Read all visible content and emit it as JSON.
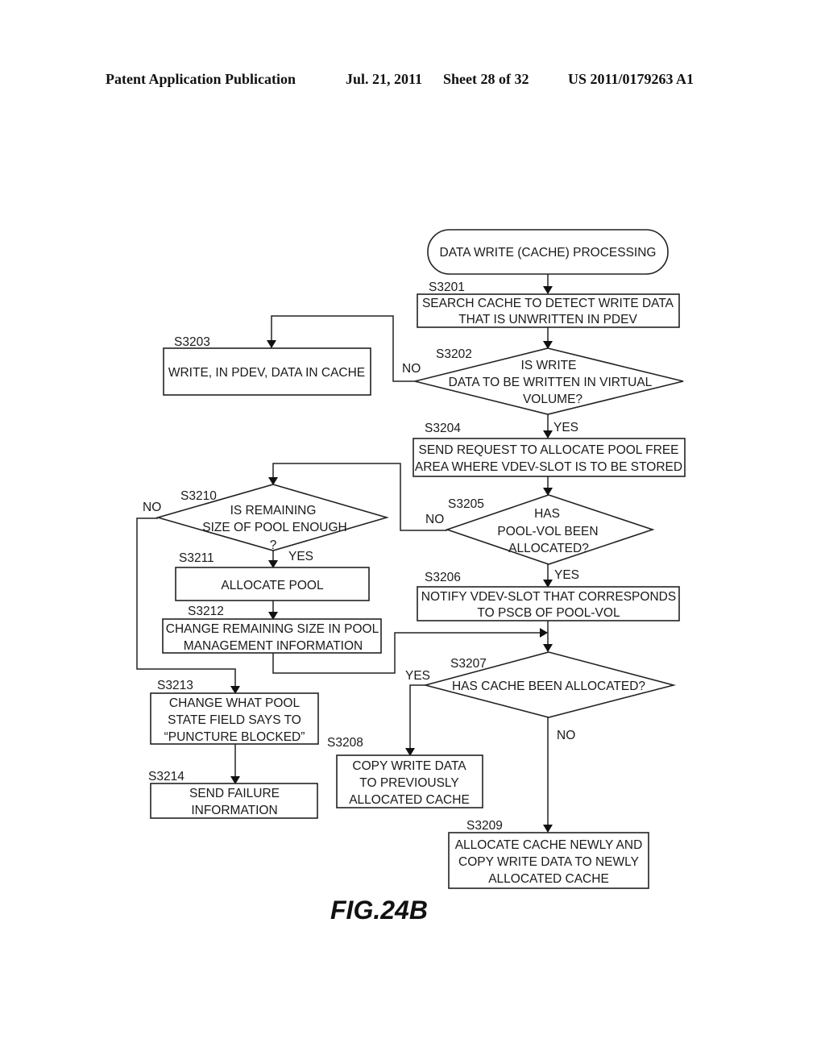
{
  "header": {
    "publication": "Patent Application Publication",
    "date": "Jul. 21, 2011",
    "sheet": "Sheet 28 of 32",
    "number": "US 2011/0179263 A1"
  },
  "figure_label": "FIG.24B",
  "nodes": {
    "start": {
      "type": "terminal",
      "lines": [
        "DATA WRITE (CACHE) PROCESSING"
      ]
    },
    "s3201": {
      "step": "S3201",
      "type": "process",
      "lines": [
        "SEARCH CACHE TO DETECT WRITE DATA",
        "THAT IS UNWRITTEN IN PDEV"
      ]
    },
    "s3202": {
      "step": "S3202",
      "type": "decision",
      "lines": [
        "IS WRITE",
        "DATA TO BE WRITTEN IN VIRTUAL",
        "VOLUME?"
      ]
    },
    "s3203": {
      "step": "S3203",
      "type": "process",
      "lines": [
        "WRITE, IN PDEV, DATA IN CACHE"
      ]
    },
    "s3204": {
      "step": "S3204",
      "type": "process",
      "lines": [
        "SEND REQUEST TO ALLOCATE POOL FREE",
        "AREA WHERE VDEV-SLOT IS TO BE STORED"
      ]
    },
    "s3205": {
      "step": "S3205",
      "type": "decision",
      "lines": [
        "HAS",
        "POOL-VOL BEEN",
        "ALLOCATED?"
      ]
    },
    "s3206": {
      "step": "S3206",
      "type": "process",
      "lines": [
        "NOTIFY VDEV-SLOT THAT CORRESPONDS",
        "TO PSCB OF POOL-VOL"
      ]
    },
    "s3207": {
      "step": "S3207",
      "type": "decision",
      "lines": [
        "HAS CACHE BEEN ALLOCATED?"
      ]
    },
    "s3208": {
      "step": "S3208",
      "type": "process",
      "lines": [
        "COPY WRITE DATA",
        "TO PREVIOUSLY",
        "ALLOCATED CACHE"
      ]
    },
    "s3209": {
      "step": "S3209",
      "type": "process",
      "lines": [
        "ALLOCATE CACHE NEWLY AND",
        "COPY WRITE DATA TO NEWLY",
        "ALLOCATED CACHE"
      ]
    },
    "s3210": {
      "step": "S3210",
      "type": "decision",
      "lines": [
        "IS REMAINING",
        "SIZE OF POOL ENOUGH",
        "?"
      ]
    },
    "s3211": {
      "step": "S3211",
      "type": "process",
      "lines": [
        "ALLOCATE POOL"
      ]
    },
    "s3212": {
      "step": "S3212",
      "type": "process",
      "lines": [
        "CHANGE REMAINING SIZE IN POOL",
        "MANAGEMENT INFORMATION"
      ]
    },
    "s3213": {
      "step": "S3213",
      "type": "process",
      "lines": [
        "CHANGE WHAT POOL",
        "STATE FIELD SAYS TO",
        "“PUNCTURE BLOCKED”"
      ]
    },
    "s3214": {
      "step": "S3214",
      "type": "process",
      "lines": [
        "SEND FAILURE",
        "INFORMATION"
      ]
    }
  },
  "edge_labels": {
    "s3202_no": "NO",
    "s3202_yes": "YES",
    "s3205_no": "NO",
    "s3205_yes": "YES",
    "s3207_yes": "YES",
    "s3207_no": "NO",
    "s3210_no": "NO",
    "s3210_yes": "YES"
  },
  "edges": [
    {
      "from": "start",
      "to": "s3201"
    },
    {
      "from": "s3201",
      "to": "s3202"
    },
    {
      "from": "s3202",
      "to": "s3203",
      "label": "NO"
    },
    {
      "from": "s3202",
      "to": "s3204",
      "label": "YES"
    },
    {
      "from": "s3204",
      "to": "s3205"
    },
    {
      "from": "s3205",
      "to": "s3210",
      "label": "NO"
    },
    {
      "from": "s3205",
      "to": "s3206",
      "label": "YES"
    },
    {
      "from": "s3210",
      "to": "s3211",
      "label": "YES"
    },
    {
      "from": "s3210",
      "to": "s3213",
      "label": "NO"
    },
    {
      "from": "s3211",
      "to": "s3212"
    },
    {
      "from": "s3212",
      "to": "s3207"
    },
    {
      "from": "s3206",
      "to": "s3207"
    },
    {
      "from": "s3207",
      "to": "s3208",
      "label": "YES"
    },
    {
      "from": "s3207",
      "to": "s3209",
      "label": "NO"
    },
    {
      "from": "s3213",
      "to": "s3214"
    }
  ]
}
